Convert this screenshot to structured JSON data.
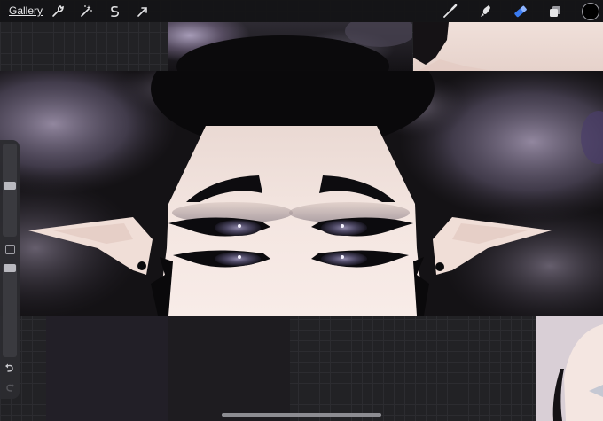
{
  "toolbar": {
    "gallery_label": "Gallery",
    "left_tools": [
      {
        "name": "actions-icon"
      },
      {
        "name": "adjustments-icon"
      },
      {
        "name": "selection-icon"
      },
      {
        "name": "transform-icon"
      }
    ],
    "right_tools": [
      {
        "name": "brush-icon",
        "active": false
      },
      {
        "name": "smudge-icon",
        "active": false
      },
      {
        "name": "eraser-icon",
        "active": true
      },
      {
        "name": "layers-icon",
        "active": false
      }
    ],
    "current_color": "#000000",
    "active_tool_color": "#3a7bf0"
  },
  "sidebar": {
    "brush_size_level": 0.55,
    "opacity_level": 0.1
  },
  "canvas": {
    "background_color": "#141215",
    "skin_color": "#f2e4de",
    "iris_color": "#6e6a86",
    "cloud_color": "#8c8098"
  }
}
